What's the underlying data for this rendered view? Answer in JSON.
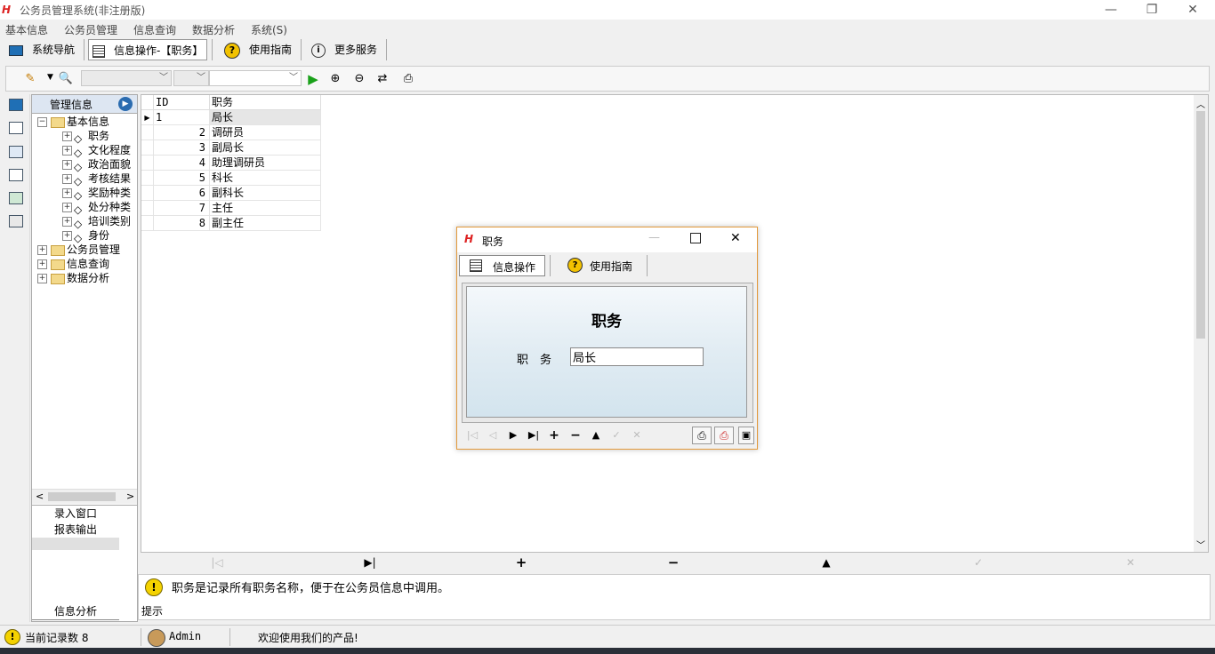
{
  "window": {
    "title": "公务员管理系统(非注册版)",
    "logo_text": "H",
    "controls": {
      "minimize": "—",
      "restore": "❐",
      "close": "✕"
    }
  },
  "menu": [
    "基本信息",
    "公务员管理",
    "信息查询",
    "数据分析",
    "系统(S)"
  ],
  "nav_toolbar": {
    "items": [
      {
        "label": "系统导航",
        "icon": "monitor-icon"
      },
      {
        "label": "信息操作-【职务】",
        "icon": "form-icon",
        "active": true
      },
      {
        "label": "使用指南",
        "icon": "help-icon"
      },
      {
        "label": "更多服务",
        "icon": "info-icon"
      }
    ]
  },
  "toolbar": {
    "combo1": "",
    "combo2": "",
    "combo3": "",
    "icons": [
      "pencil-icon",
      "search-preview-icon",
      "run-icon",
      "zoom-in-icon",
      "zoom-out-icon",
      "refresh-icon",
      "print-icon"
    ]
  },
  "tree": {
    "header": "管理信息",
    "root": "基本信息",
    "children": [
      "职务",
      "文化程度",
      "政治面貌",
      "考核结果",
      "奖励种类",
      "处分种类",
      "培训类别",
      "身份"
    ],
    "others": [
      "公务员管理",
      "信息查询",
      "数据分析"
    ]
  },
  "left_panel": {
    "buttons": [
      "录入窗口",
      "报表输出"
    ],
    "bottom_label": "信息分析"
  },
  "grid": {
    "columns": [
      "ID",
      "职务"
    ],
    "rows": [
      {
        "id": "1",
        "name": "局长",
        "selected": true
      },
      {
        "id": "2",
        "name": "调研员"
      },
      {
        "id": "3",
        "name": "副局长"
      },
      {
        "id": "4",
        "name": "助理调研员"
      },
      {
        "id": "5",
        "name": "科长"
      },
      {
        "id": "6",
        "name": "副科长"
      },
      {
        "id": "7",
        "name": "主任"
      },
      {
        "id": "8",
        "name": "副主任"
      }
    ]
  },
  "dialog": {
    "title": "职务",
    "tabs": [
      "信息操作",
      "使用指南"
    ],
    "form_title": "职务",
    "field_label": "职　务",
    "field_value": "局长"
  },
  "hint": {
    "text": "职务是记录所有职务名称，便于在公务员信息中调用。",
    "label": "提示"
  },
  "status": {
    "record_count": "当前记录数 8",
    "user": "Admin",
    "welcome": "欢迎使用我们的产品!"
  },
  "colors": {
    "dialog_border": "#e39a3c",
    "run_green": "#1aa11a",
    "tree_header": "#dde6f2"
  }
}
